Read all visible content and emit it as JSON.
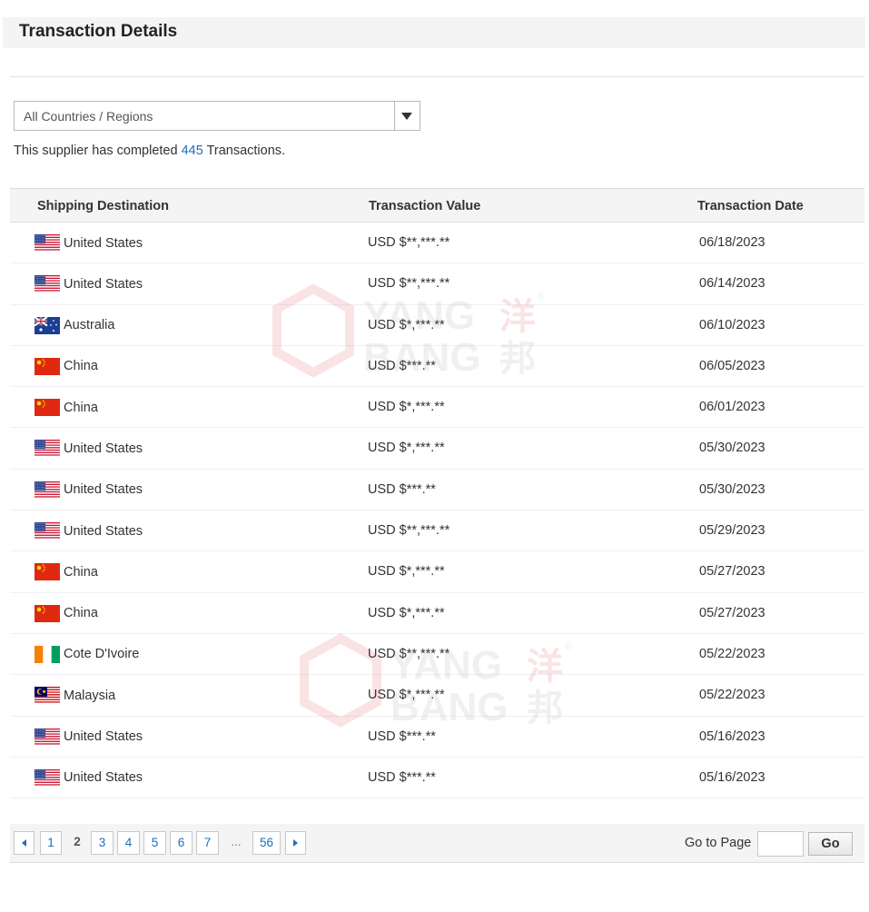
{
  "page": {
    "title": "Transaction Details"
  },
  "filter": {
    "selected": "All Countries / Regions"
  },
  "summary": {
    "prefix": "This supplier has completed",
    "count": "445",
    "suffix": "Transactions."
  },
  "table": {
    "columns": [
      "Shipping Destination",
      "Transaction Value",
      "Transaction Date"
    ],
    "rows": [
      {
        "country": "United States",
        "flag": "us-flag-icon",
        "value": "USD $**,***.**",
        "date": "06/18/2023"
      },
      {
        "country": "United States",
        "flag": "us-flag-icon",
        "value": "USD $**,***.**",
        "date": "06/14/2023"
      },
      {
        "country": "Australia",
        "flag": "au-flag-icon",
        "value": "USD $*,***.**",
        "date": "06/10/2023"
      },
      {
        "country": "China",
        "flag": "cn-flag-icon",
        "value": "USD $***.**",
        "date": "06/05/2023"
      },
      {
        "country": "China",
        "flag": "cn-flag-icon",
        "value": "USD $*,***.**",
        "date": "06/01/2023"
      },
      {
        "country": "United States",
        "flag": "us-flag-icon",
        "value": "USD $*,***.**",
        "date": "05/30/2023"
      },
      {
        "country": "United States",
        "flag": "us-flag-icon",
        "value": "USD $***.**",
        "date": "05/30/2023"
      },
      {
        "country": "United States",
        "flag": "us-flag-icon",
        "value": "USD $**,***.**",
        "date": "05/29/2023"
      },
      {
        "country": "China",
        "flag": "cn-flag-icon",
        "value": "USD $*,***.**",
        "date": "05/27/2023"
      },
      {
        "country": "China",
        "flag": "cn-flag-icon",
        "value": "USD $*,***.**",
        "date": "05/27/2023"
      },
      {
        "country": "Cote D'Ivoire",
        "flag": "ci-flag-icon",
        "value": "USD $**,***.**",
        "date": "05/22/2023"
      },
      {
        "country": "Malaysia",
        "flag": "my-flag-icon",
        "value": "USD $*,***.**",
        "date": "05/22/2023"
      },
      {
        "country": "United States",
        "flag": "us-flag-icon",
        "value": "USD $***.**",
        "date": "05/16/2023"
      },
      {
        "country": "United States",
        "flag": "us-flag-icon",
        "value": "USD $***.**",
        "date": "05/16/2023"
      }
    ]
  },
  "watermark": {
    "line1": "YANG",
    "line2": "BANG",
    "cjk1": "洋",
    "cjk2": "邦",
    "mark": "®"
  },
  "pagination": {
    "pages": [
      "1",
      "2",
      "3",
      "4",
      "5",
      "6",
      "7"
    ],
    "current": "2",
    "ellipsis": "...",
    "last": "56",
    "goto_label": "Go to Page",
    "go_label": "Go"
  },
  "colors": {
    "link": "#1f6dbd",
    "header_bg": "#f4f4f4"
  }
}
